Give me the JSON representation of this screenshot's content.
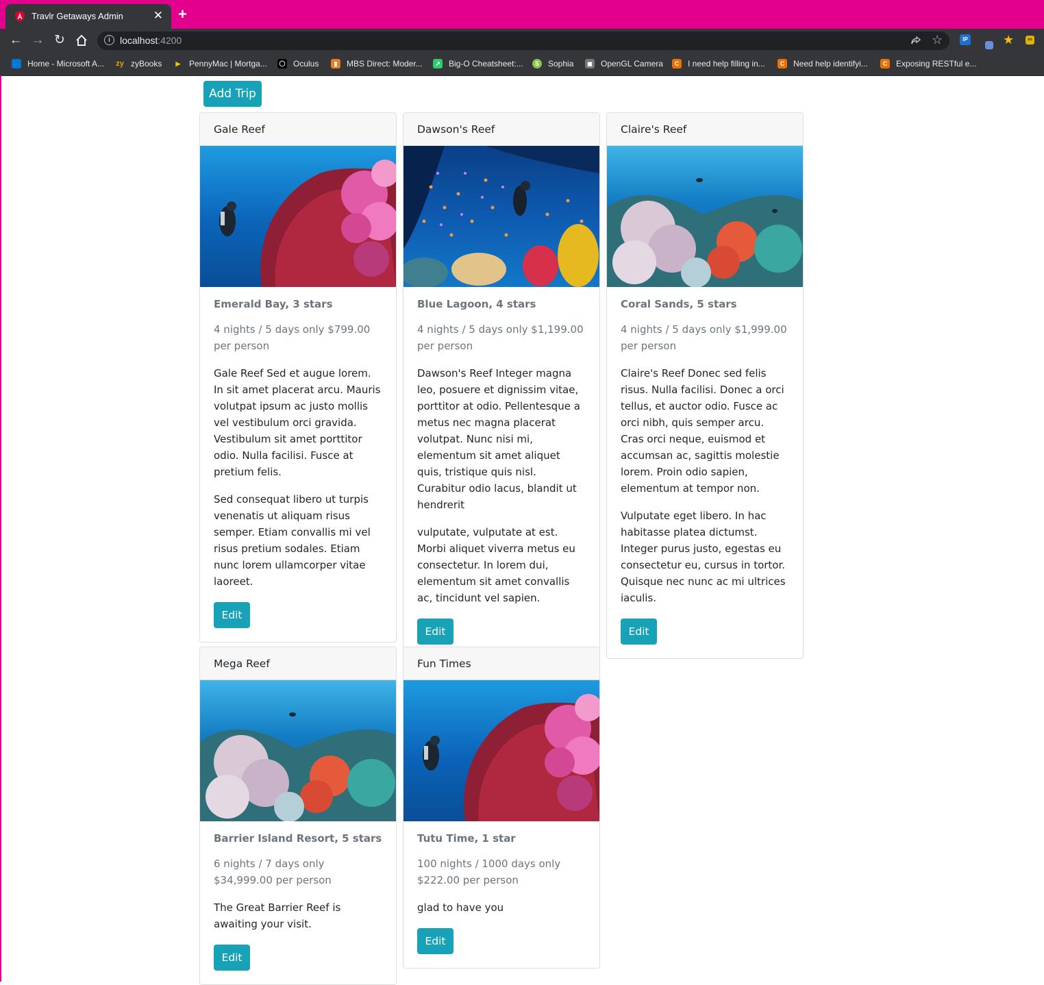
{
  "browser": {
    "tab_title": "Travlr Getaways Admin",
    "tab_close": "✕",
    "new_tab": "+",
    "url_host": "localhost",
    "url_port": ":4200",
    "bookmarks": [
      {
        "label": "Home - Microsoft A...",
        "icon": "azure-icon",
        "color": "#0078d4",
        "glyph": ""
      },
      {
        "label": "zyBooks",
        "icon": "zybooks-icon",
        "color": "#35363a",
        "glyph": "zy"
      },
      {
        "label": "PennyMac | Mortga...",
        "icon": "pennymac-icon",
        "color": "#35363a",
        "glyph": "▶"
      },
      {
        "label": "Oculus",
        "icon": "oculus-icon",
        "color": "#000000",
        "glyph": "◯"
      },
      {
        "label": "MBS Direct: Moder...",
        "icon": "mbs-icon",
        "color": "#e67e22",
        "glyph": "▮"
      },
      {
        "label": "Big-O Cheatsheet:...",
        "icon": "bigo-icon",
        "color": "#2ecc71",
        "glyph": "↗"
      },
      {
        "label": "Sophia",
        "icon": "sophia-icon",
        "color": "#8bc34a",
        "glyph": "S"
      },
      {
        "label": "OpenGL Camera",
        "icon": "opengl-icon",
        "color": "#777777",
        "glyph": "◼"
      },
      {
        "label": "I need help filling in...",
        "icon": "chegg-icon",
        "color": "#eb7100",
        "glyph": "C"
      },
      {
        "label": "Need help identifyi...",
        "icon": "chegg-icon",
        "color": "#eb7100",
        "glyph": "C"
      },
      {
        "label": "Exposing RESTful e...",
        "icon": "chegg-icon",
        "color": "#eb7100",
        "glyph": "C"
      }
    ]
  },
  "page": {
    "add_trip_label": "Add Trip",
    "edit_label": "Edit"
  },
  "trips": [
    {
      "name": "Gale Reef",
      "title": "Emerald Bay, 3 stars",
      "price": "4 nights / 5 days only $799.00 per person",
      "paragraphs": [
        "Gale Reef Sed et augue lorem. In sit amet placerat arcu. Mauris volutpat ipsum ac justo mollis vel vestibulum orci gravida. Vestibulum sit amet porttitor odio. Nulla facilisi. Fusce at pretium felis.",
        "Sed consequat libero ut turpis venenatis ut aliquam risus semper. Etiam convallis mi vel risus pretium sodales. Etiam nunc lorem ullamcorper vitae laoreet."
      ],
      "image": "reef-diver-fan-coral-photo"
    },
    {
      "name": "Dawson's Reef",
      "title": "Blue Lagoon, 4 stars",
      "price": "4 nights / 5 days only $1,199.00 per person",
      "paragraphs": [
        "Dawson's Reef Integer magna leo, posuere et dignissim vitae, porttitor at odio. Pellentesque a metus nec magna placerat volutpat. Nunc nisi mi, elementum sit amet aliquet quis, tristique quis nisl. Curabitur odio lacus, blandit ut hendrerit",
        "vulputate, vulputate at est. Morbi aliquet viverra metus eu consectetur. In lorem dui, elementum sit amet convallis ac, tincidunt vel sapien."
      ],
      "image": "reef-diver-fish-school-photo"
    },
    {
      "name": "Claire's Reef",
      "title": "Coral Sands, 5 stars",
      "price": "4 nights / 5 days only $1,999.00 per person",
      "paragraphs": [
        "Claire's Reef Donec sed felis risus. Nulla facilisi. Donec a orci tellus, et auctor odio. Fusce ac orci nibh, quis semper arcu. Cras orci neque, euismod et accumsan ac, sagittis molestie lorem. Proin odio sapien, elementum at tempor non.",
        "Vulputate eget libero. In hac habitasse platea dictumst. Integer purus justo, egestas eu consectetur eu, cursus in tortor. Quisque nec nunc ac mi ultrices iaculis."
      ],
      "image": "reef-soft-coral-photo"
    },
    {
      "name": "Mega Reef",
      "title": "Barrier Island Resort, 5 stars",
      "price": "6 nights / 7 days only $34,999.00 per person",
      "paragraphs": [
        "The Great Barrier Reef is awaiting your visit."
      ],
      "image": "reef-soft-coral-photo"
    },
    {
      "name": "Fun Times",
      "title": "Tutu Time, 1 star",
      "price": "100 nights / 1000 days only $222.00 per person",
      "paragraphs": [
        "glad to have you"
      ],
      "image": "reef-diver-fan-coral-photo"
    }
  ]
}
